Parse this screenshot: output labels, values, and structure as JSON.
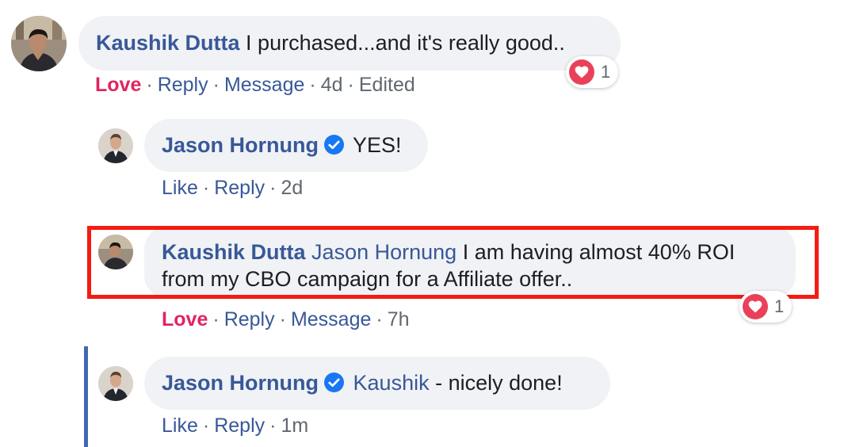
{
  "comments": [
    {
      "author": "Kaushik Dutta",
      "text": "I purchased...and it's really good..",
      "actions": {
        "reaction": "Love",
        "reply": "Reply",
        "message": "Message",
        "time": "4d",
        "edited": "Edited"
      },
      "reaction_count": "1",
      "reaction_icon": "heart-icon"
    },
    {
      "author": "Jason Hornung",
      "verified": true,
      "text": "YES!",
      "actions": {
        "reaction": "Like",
        "reply": "Reply",
        "time": "2d"
      }
    },
    {
      "author": "Kaushik Dutta",
      "mention": "Jason Hornung",
      "text_line1": "I am having almost 40% ROI",
      "text_line2": "from my CBO campaign for a Affiliate offer..",
      "actions": {
        "reaction": "Love",
        "reply": "Reply",
        "message": "Message",
        "time": "7h"
      },
      "reaction_count": "1",
      "reaction_icon": "heart-icon",
      "highlighted": true,
      "highlight_color": "#f41c12"
    },
    {
      "author": "Jason Hornung",
      "verified": true,
      "mention": "Kaushik",
      "text": "- nicely done!",
      "actions": {
        "reaction": "Like",
        "reply": "Reply",
        "time": "1m"
      }
    }
  ],
  "colors": {
    "link": "#385898",
    "love": "#e0245e",
    "bubble": "#f0f2f5",
    "verified": "#1877f2",
    "thread_bar": "#4267b2"
  }
}
